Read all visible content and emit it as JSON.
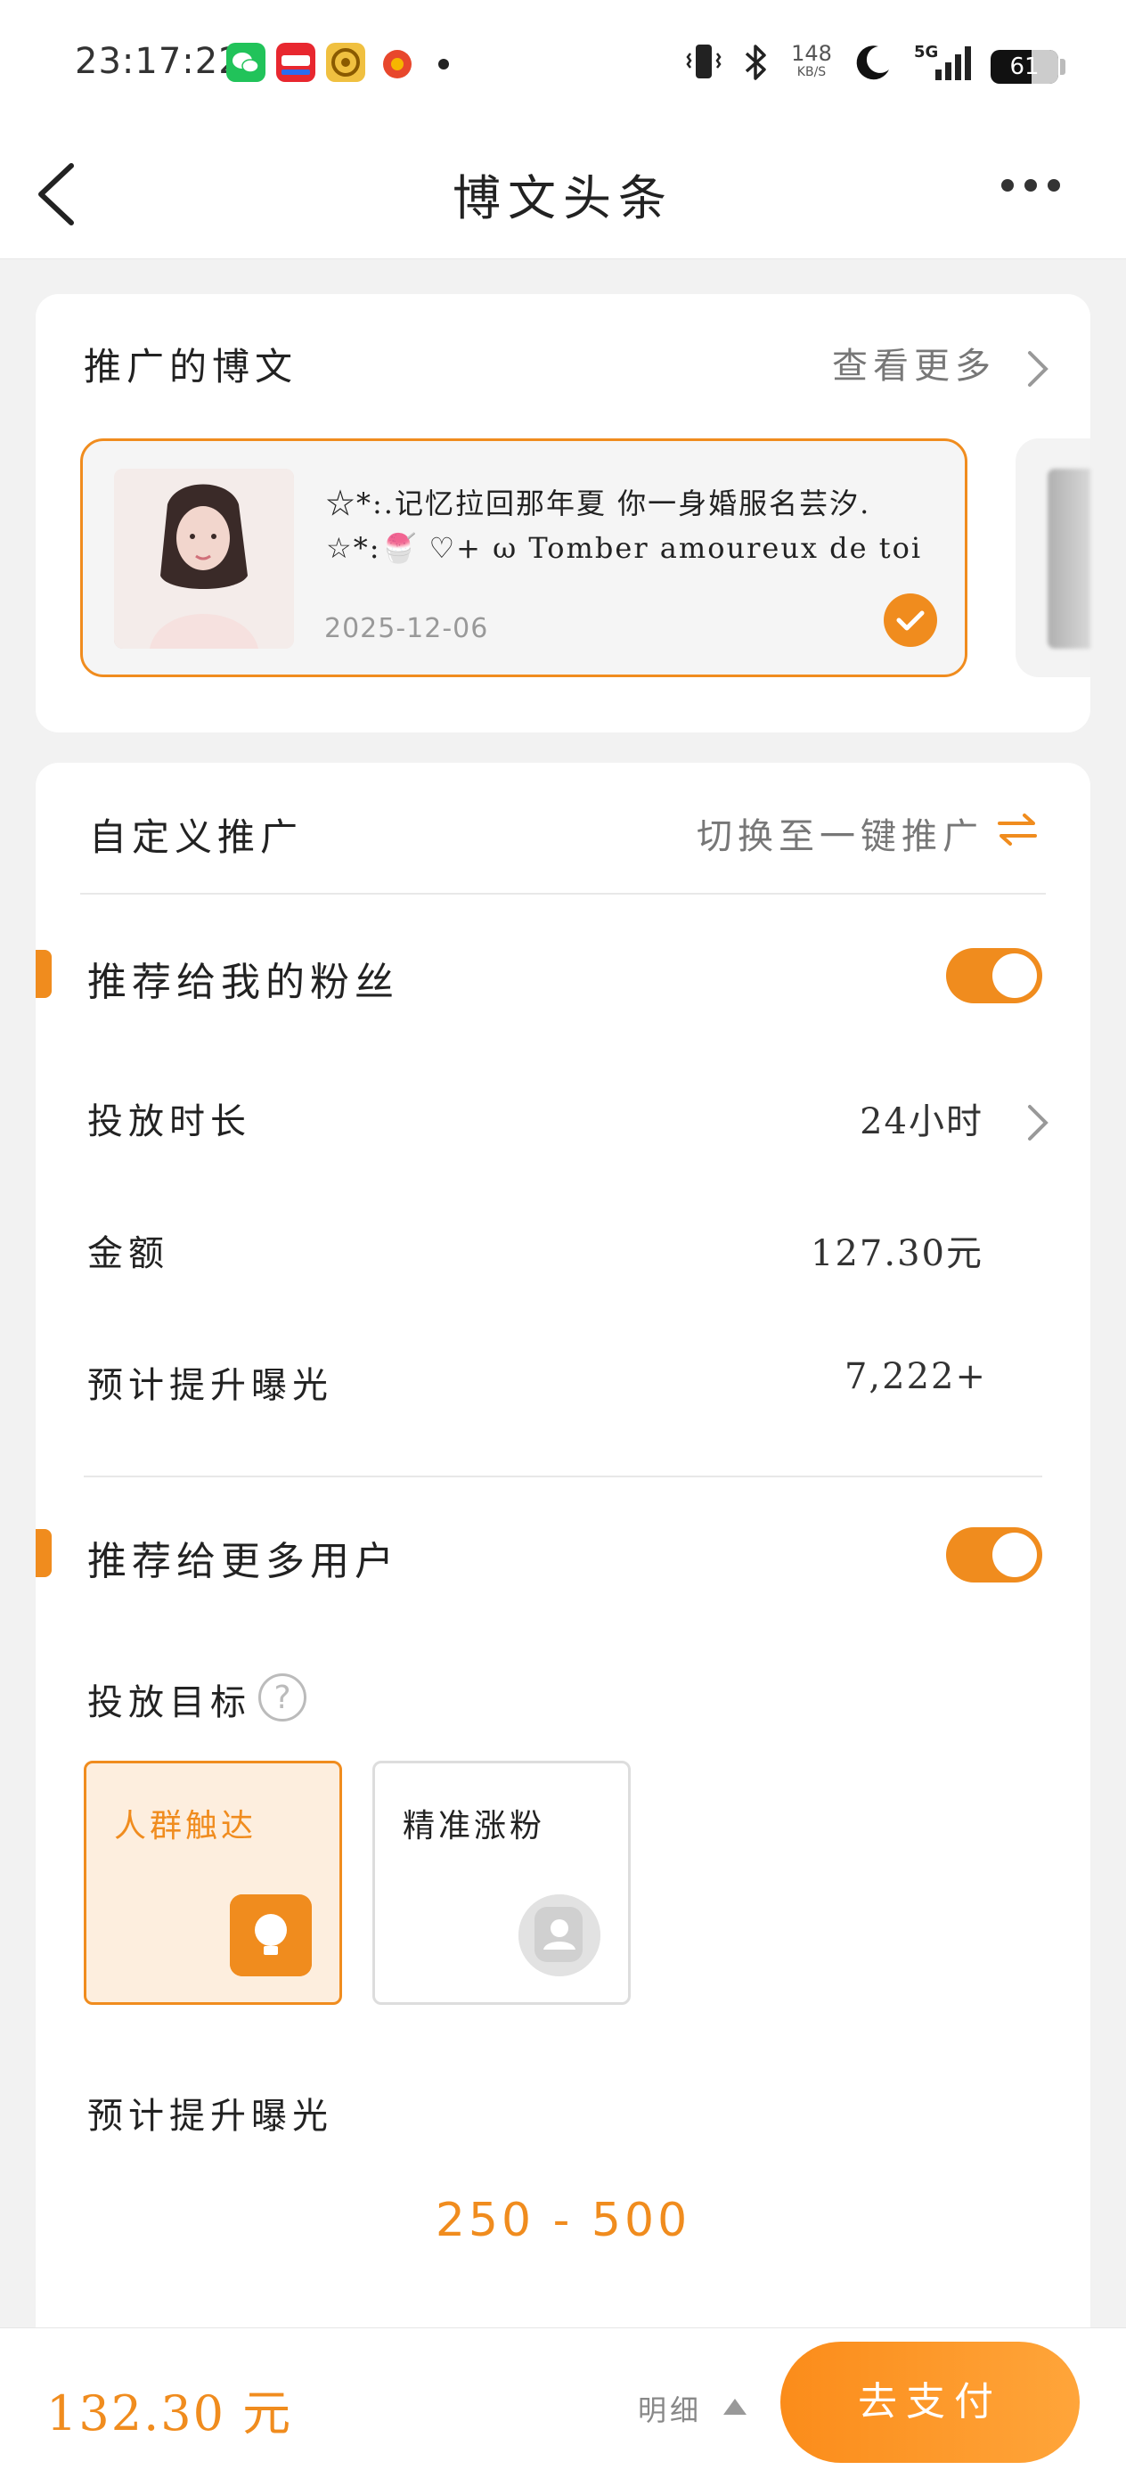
{
  "status_bar": {
    "time": "23:17:22",
    "net_speed": "148",
    "net_unit": "KB/S",
    "network": "5G",
    "battery": "61",
    "app_icons": [
      "wechat-icon",
      "xiaohongshu-icon",
      "app-icon",
      "weibo-icon"
    ]
  },
  "header": {
    "title": "博文头条"
  },
  "promoted_posts": {
    "heading": "推广的博文",
    "see_more": "查看更多",
    "post": {
      "line1": "☆*:.记忆拉回那年夏 你一身婚服名芸汐.",
      "line2": "☆*:🍧 ♡+ ω Tomber amoureux de toi est mon",
      "date": "2025-12-06",
      "selected": true
    }
  },
  "custom_promo": {
    "heading": "自定义推广",
    "switch_label": "切换至一键推广",
    "fans": {
      "label": "推荐给我的粉丝",
      "enabled": true,
      "duration_label": "投放时长",
      "duration_value": "24小时",
      "amount_label": "金额",
      "amount_value": "127.30元",
      "exposure_label": "预计提升曝光",
      "exposure_value": "7,222+"
    },
    "more_users": {
      "label": "推荐给更多用户",
      "enabled": true,
      "target_label": "投放目标",
      "help": "?",
      "options": [
        {
          "label": "人群触达",
          "selected": true,
          "icon": "bulb-icon"
        },
        {
          "label": "精准涨粉",
          "selected": false,
          "icon": "person-icon"
        }
      ],
      "exposure_label": "预计提升曝光",
      "exposure_range": "250 - 500"
    }
  },
  "bottom_bar": {
    "total": "132.30 元",
    "detail": "明细",
    "pay": "去支付"
  },
  "colors": {
    "accent": "#f08c1e",
    "background": "#f2f2f2"
  }
}
